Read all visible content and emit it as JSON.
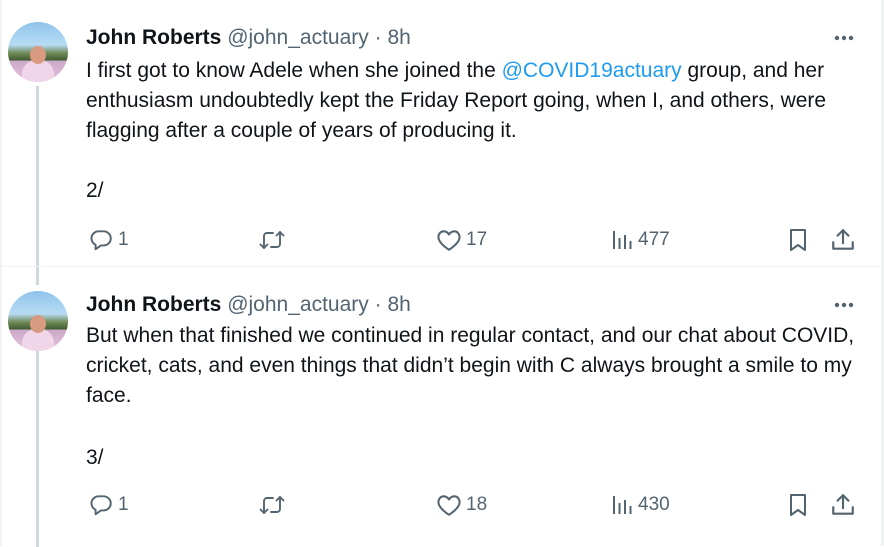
{
  "tweets": [
    {
      "author_name": "John Roberts",
      "handle": "@john_actuary",
      "separator": "·",
      "time": "8h",
      "text_before_mention": "I first got to know Adele when she joined the ",
      "mention": "@COVID19actuary",
      "text_after_mention": " group, and her enthusiasm undoubtedly kept the Friday Report going, when I, and others, were flagging after a couple of years of producing it.",
      "sequence": "2/",
      "replies": "1",
      "retweets": "",
      "likes": "17",
      "views": "477"
    },
    {
      "author_name": "John Roberts",
      "handle": "@john_actuary",
      "separator": "·",
      "time": "8h",
      "text": "But when that finished we continued in regular contact, and our chat about COVID, cricket, cats, and even things that didn’t begin with C always brought a smile to my face.",
      "sequence": "3/",
      "replies": "1",
      "retweets": "",
      "likes": "18",
      "views": "430"
    }
  ],
  "icons": {
    "more": "more-horizontal-icon",
    "reply": "reply-icon",
    "retweet": "retweet-icon",
    "like": "heart-icon",
    "views": "views-icon",
    "bookmark": "bookmark-icon",
    "share": "share-icon"
  },
  "colors": {
    "text": "#0f1419",
    "secondary": "#536471",
    "link": "#1d9bf0",
    "thread_line": "#cfd9de",
    "divider": "#eff3f4"
  }
}
